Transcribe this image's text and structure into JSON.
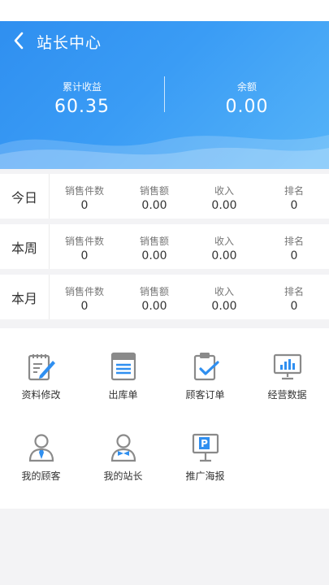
{
  "header": {
    "title": "站长中心"
  },
  "summary": {
    "cumulative_label": "累计收益",
    "cumulative_value": "60.35",
    "balance_label": "余额",
    "balance_value": "0.00"
  },
  "columns": [
    "销售件数",
    "销售额",
    "收入",
    "排名"
  ],
  "periods": [
    {
      "label": "今日",
      "values": [
        "0",
        "0.00",
        "0.00",
        "0"
      ]
    },
    {
      "label": "本周",
      "values": [
        "0",
        "0.00",
        "0.00",
        "0"
      ]
    },
    {
      "label": "本月",
      "values": [
        "0",
        "0.00",
        "0.00",
        "0"
      ]
    }
  ],
  "menu": [
    {
      "label": "资料修改",
      "icon": "edit-profile-icon"
    },
    {
      "label": "出库单",
      "icon": "outbound-list-icon"
    },
    {
      "label": "顾客订单",
      "icon": "clipboard-check-icon"
    },
    {
      "label": "经营数据",
      "icon": "monitor-chart-icon"
    },
    {
      "label": "我的顾客",
      "icon": "customer-person-icon"
    },
    {
      "label": "我的站长",
      "icon": "manager-person-icon"
    },
    {
      "label": "推广海报",
      "icon": "poster-sign-icon"
    }
  ],
  "colors": {
    "accent": "#3a9cf5",
    "icon_gray": "#8a8a8a",
    "icon_blue": "#2f8ff0"
  }
}
